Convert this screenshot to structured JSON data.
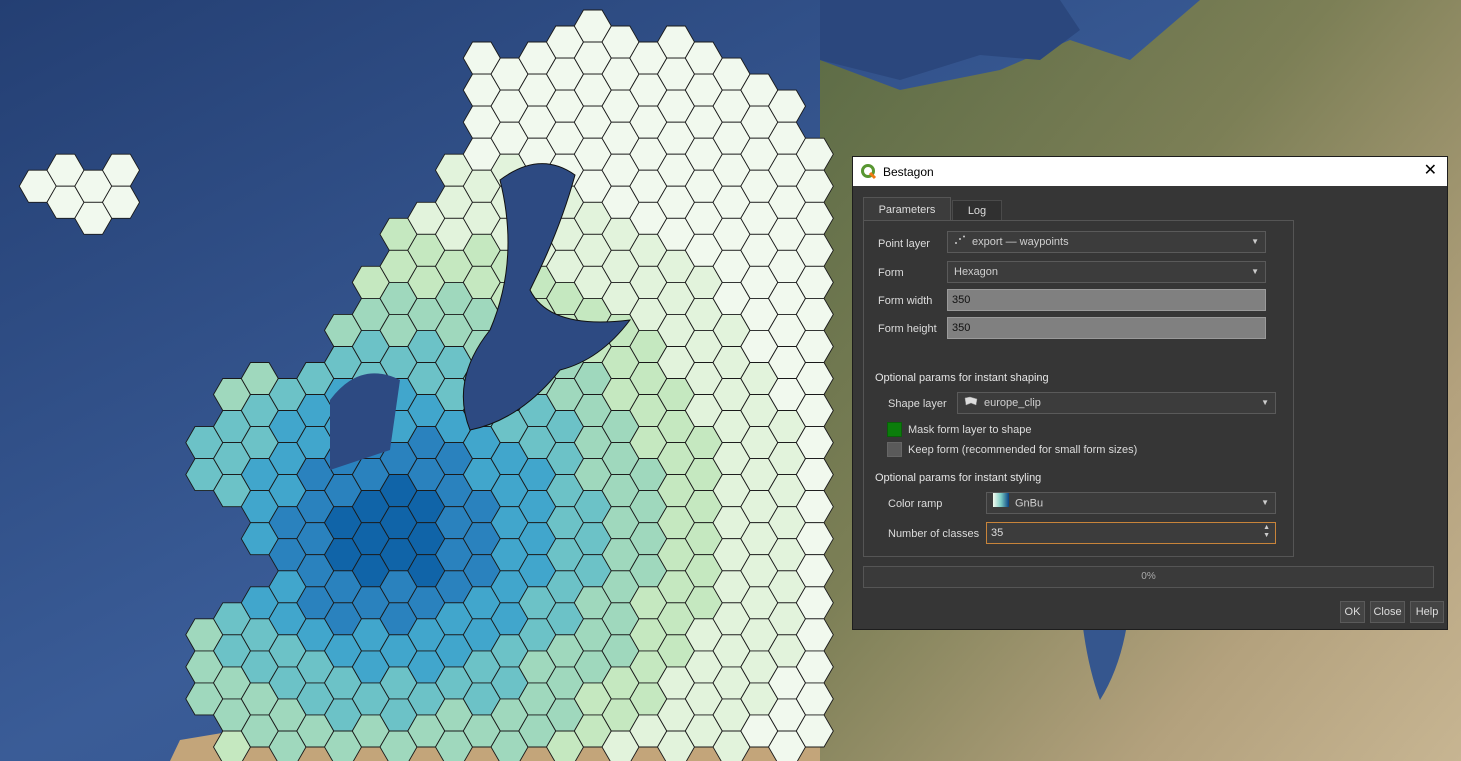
{
  "dialog": {
    "title": "Bestagon",
    "tabs": [
      {
        "label": "Parameters",
        "active": true
      },
      {
        "label": "Log",
        "active": false
      }
    ],
    "point_layer": {
      "label": "Point layer",
      "value": "export — waypoints",
      "icon": "point-layer-icon"
    },
    "form": {
      "label": "Form",
      "value": "Hexagon"
    },
    "form_width": {
      "label": "Form width",
      "value": "350"
    },
    "form_height": {
      "label": "Form height",
      "value": "350"
    },
    "shaping": {
      "title": "Optional params for instant shaping",
      "shape_layer": {
        "label": "Shape layer",
        "value": "europe_clip",
        "icon": "polygon-layer-icon"
      },
      "mask": {
        "label": "Mask form layer to shape",
        "checked": true
      },
      "keep": {
        "label": "Keep form (recommended for small form sizes)",
        "checked": false
      }
    },
    "styling": {
      "title": "Optional params for instant styling",
      "color_ramp": {
        "label": "Color ramp",
        "value": "GnBu"
      },
      "num_classes": {
        "label": "Number of classes",
        "value": "35"
      }
    },
    "progress": {
      "text": "0%",
      "value": 0
    },
    "buttons": {
      "ok": "OK",
      "close": "Close",
      "help": "Help"
    }
  },
  "colors": {
    "accent_checkbox": "#0b7d0b",
    "focus_border": "#c8843a",
    "hex_ramp": [
      "#f1f9ee",
      "#e2f3dc",
      "#c5e8c0",
      "#9fd8bd",
      "#6cc2c7",
      "#41a6cc",
      "#2a82be",
      "#1064a8"
    ]
  }
}
